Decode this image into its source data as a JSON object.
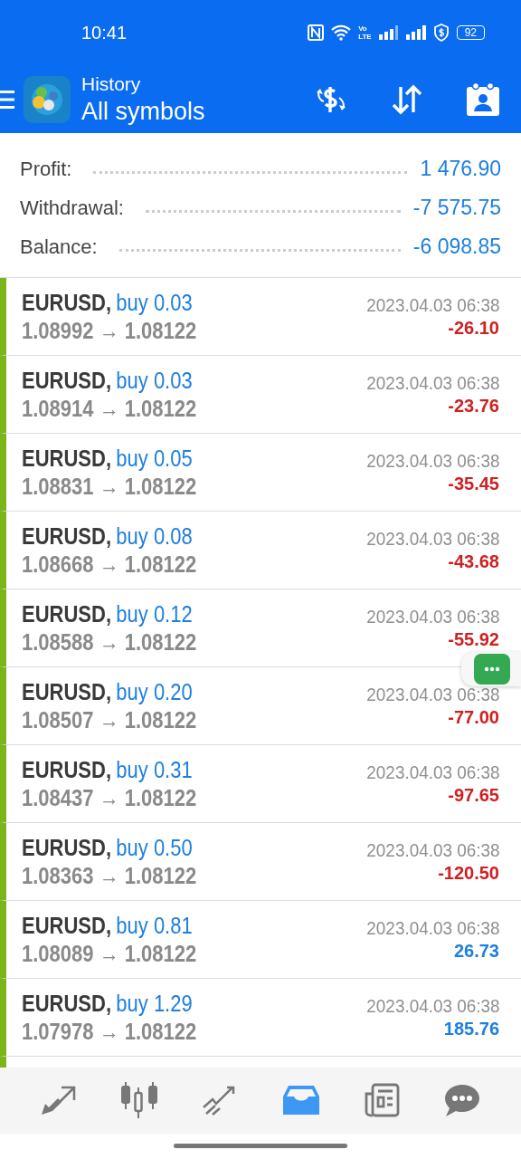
{
  "status_bar": {
    "time": "10:41",
    "network_tags": [
      "Vo",
      "LTE"
    ],
    "battery": "92"
  },
  "header": {
    "title": "History",
    "subtitle": "All symbols"
  },
  "summary": [
    {
      "label": "Profit:",
      "value": "1 476.90"
    },
    {
      "label": "Withdrawal:",
      "value": "-7 575.75"
    },
    {
      "label": "Balance:",
      "value": "-6 098.85"
    }
  ],
  "deals": [
    {
      "symbol": "EURUSD,",
      "side": "buy 0.03",
      "prices": "1.08992 → 1.08122",
      "time": "2023.04.03 06:38",
      "profit": "-26.10",
      "loss": true
    },
    {
      "symbol": "EURUSD,",
      "side": "buy 0.03",
      "prices": "1.08914 → 1.08122",
      "time": "2023.04.03 06:38",
      "profit": "-23.76",
      "loss": true
    },
    {
      "symbol": "EURUSD,",
      "side": "buy 0.05",
      "prices": "1.08831 → 1.08122",
      "time": "2023.04.03 06:38",
      "profit": "-35.45",
      "loss": true
    },
    {
      "symbol": "EURUSD,",
      "side": "buy 0.08",
      "prices": "1.08668 → 1.08122",
      "time": "2023.04.03 06:38",
      "profit": "-43.68",
      "loss": true
    },
    {
      "symbol": "EURUSD,",
      "side": "buy 0.12",
      "prices": "1.08588 → 1.08122",
      "time": "2023.04.03 06:38",
      "profit": "-55.92",
      "loss": true
    },
    {
      "symbol": "EURUSD,",
      "side": "buy 0.20",
      "prices": "1.08507 → 1.08122",
      "time": "2023.04.03 06:38",
      "profit": "-77.00",
      "loss": true
    },
    {
      "symbol": "EURUSD,",
      "side": "buy 0.31",
      "prices": "1.08437 → 1.08122",
      "time": "2023.04.03 06:38",
      "profit": "-97.65",
      "loss": true
    },
    {
      "symbol": "EURUSD,",
      "side": "buy 0.50",
      "prices": "1.08363 → 1.08122",
      "time": "2023.04.03 06:38",
      "profit": "-120.50",
      "loss": true
    },
    {
      "symbol": "EURUSD,",
      "side": "buy 0.81",
      "prices": "1.08089 → 1.08122",
      "time": "2023.04.03 06:38",
      "profit": "26.73",
      "loss": false
    },
    {
      "symbol": "EURUSD,",
      "side": "buy 1.29",
      "prices": "1.07978 → 1.08122",
      "time": "2023.04.03 06:38",
      "profit": "185.76",
      "loss": false
    }
  ],
  "bottom_nav": [
    {
      "kind": "quotes",
      "selected": false
    },
    {
      "kind": "chart",
      "selected": false
    },
    {
      "kind": "trade",
      "selected": false
    },
    {
      "kind": "history",
      "selected": true
    },
    {
      "kind": "news",
      "selected": false
    },
    {
      "kind": "chat",
      "selected": false
    }
  ]
}
